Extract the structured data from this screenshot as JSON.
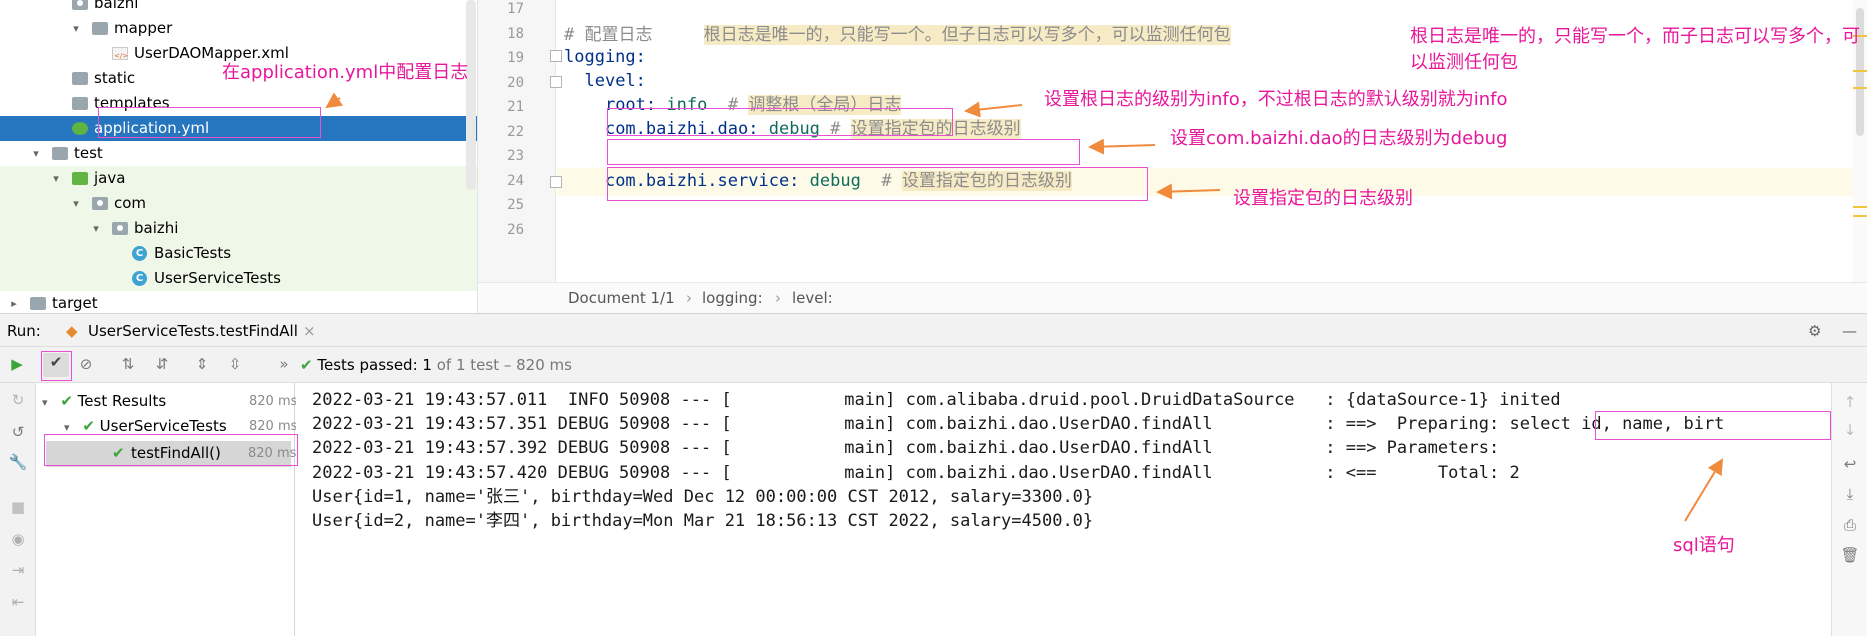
{
  "project_tree": {
    "items": [
      {
        "label": "baizhi",
        "indent": 1,
        "arrow": "",
        "icon": "package",
        "state": ""
      },
      {
        "label": "mapper",
        "indent": 2,
        "arrow": "▾",
        "icon": "folder",
        "state": ""
      },
      {
        "label": "UserDAOMapper.xml",
        "indent": 3,
        "arrow": "",
        "icon": "xml",
        "state": ""
      },
      {
        "label": "static",
        "indent": 1,
        "arrow": "",
        "icon": "folder",
        "state": ""
      },
      {
        "label": "templates",
        "indent": 1,
        "arrow": "",
        "icon": "folder",
        "state": ""
      },
      {
        "label": "application.yml",
        "indent": 1,
        "arrow": "",
        "icon": "yml",
        "state": "selected"
      },
      {
        "label": "test",
        "indent": 0,
        "arrow": "▾",
        "icon": "folder",
        "state": ""
      },
      {
        "label": "java",
        "indent": 1,
        "arrow": "▾",
        "icon": "green-folder",
        "state": "green"
      },
      {
        "label": "com",
        "indent": 2,
        "arrow": "▾",
        "icon": "package",
        "state": "green"
      },
      {
        "label": "baizhi",
        "indent": 3,
        "arrow": "▾",
        "icon": "package",
        "state": "green"
      },
      {
        "label": "BasicTests",
        "indent": 4,
        "arrow": "",
        "icon": "class",
        "state": "green"
      },
      {
        "label": "UserServiceTests",
        "indent": 4,
        "arrow": "",
        "icon": "class",
        "state": "green"
      },
      {
        "label": "target",
        "indent": -1,
        "arrow": "▸",
        "icon": "folder",
        "state": ""
      }
    ]
  },
  "editor": {
    "line_numbers": [
      "17",
      "18",
      "19",
      "20",
      "21",
      "22",
      "23",
      "24",
      "25",
      "26"
    ],
    "line18_comment": "# 配置日志",
    "line18_hl": "根日志是唯一的，只能写一个。但子日志可以写多个，可以监测任何包",
    "line19_key": "logging:",
    "line20_key": "level:",
    "line21_key": "root:",
    "line21_val": "info",
    "line21_hash": "#",
    "line21_comment": "调整根（全局）日志",
    "line22_key": "com.baizhi.dao:",
    "line22_val": "debug",
    "line22_hash": "#",
    "line22_comment": "设置指定包的日志级别",
    "line23_key": "com.baizhi.service:",
    "line23_val": "debug",
    "line23_hash": "#",
    "line23_comment": "设置指定包的日志级别"
  },
  "breadcrumbs": {
    "doc": "Document 1/1",
    "sep": "›",
    "item1": "logging:",
    "item2": "level:"
  },
  "run_panel": {
    "run_label": "Run:",
    "tab_label": "UserServiceTests.testFindAll",
    "close": "×",
    "toolbar_more": "»",
    "tests_passed": "Tests passed:",
    "tests_count": "1",
    "tests_rest": "of 1 test – 820 ms",
    "tree": [
      {
        "label": "Test Results",
        "ms": "820 ms"
      },
      {
        "label": "UserServiceTests",
        "ms": "820 ms"
      },
      {
        "label": "testFindAll()",
        "ms": "820 ms"
      }
    ]
  },
  "console": {
    "lines": [
      "2022-03-21 19:43:57.011  INFO 50908 --- [           main] com.alibaba.druid.pool.DruidDataSource   : {dataSource-1} inited",
      "2022-03-21 19:43:57.351 DEBUG 50908 --- [           main] com.baizhi.dao.UserDAO.findAll           : ==>  Preparing: select id, name, birt",
      "2022-03-21 19:43:57.392 DEBUG 50908 --- [           main] com.baizhi.dao.UserDAO.findAll           : ==> Parameters:",
      "2022-03-21 19:43:57.420 DEBUG 50908 --- [           main] com.baizhi.dao.UserDAO.findAll           : <==      Total: 2",
      "User{id=1, name='张三', birthday=Wed Dec 12 00:00:00 CST 2012, salary=3300.0}",
      "User{id=2, name='李四', birthday=Mon Mar 21 18:56:13 CST 2022, salary=4500.0}"
    ]
  },
  "annotations": {
    "config_in_yml": "在application.yml中配置日志",
    "root_unique": "根日志是唯一的，只能写一个，而子日志可以写多个，可以监测任何包",
    "root_level": "设置根日志的级别为info，不过根日志的默认级别就为info",
    "dao_level": "设置com.baizhi.dao的日志级别为debug",
    "pkg_level": "设置指定包的日志级别",
    "sql": "sql语句"
  },
  "colors": {
    "annotation": "#e8179a",
    "selection": "#2675bf",
    "pass": "#3ba53b"
  }
}
